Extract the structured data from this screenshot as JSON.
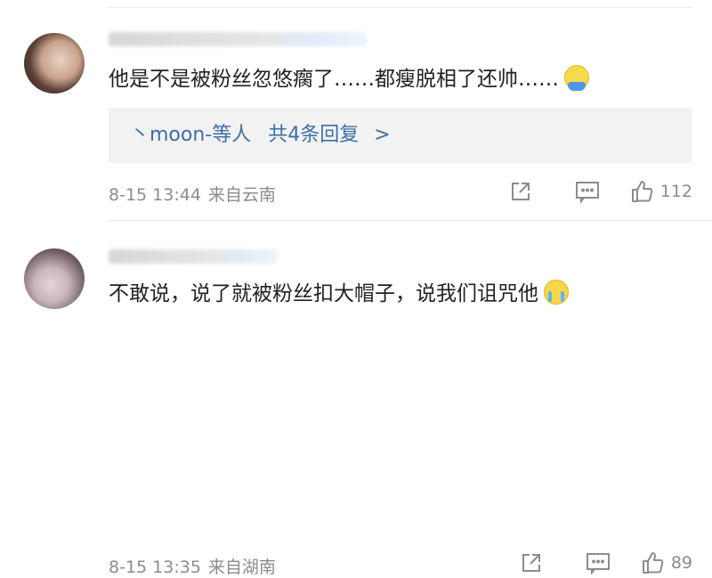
{
  "comments": [
    {
      "text": "他是不是被粉丝忽悠瘸了……都瘦脱相了还帅……",
      "emoji": "sleepy-face-emoji",
      "replies": {
        "prefix": "丶moon-等人",
        "count_label": "共4条回复",
        "arrow": ">"
      },
      "time": "8-15 13:44",
      "source": "来自云南",
      "likes": "112"
    },
    {
      "text": "不敢说，说了就被粉丝扣大帽子，说我们诅咒他",
      "emoji": "crying-face-emoji",
      "time": "8-15 13:35",
      "source": "来自湖南",
      "likes": "89"
    }
  ],
  "colors": {
    "link": "#3d6fa6",
    "meta": "#8c8c8c",
    "reply_bg": "#f2f2f2"
  }
}
